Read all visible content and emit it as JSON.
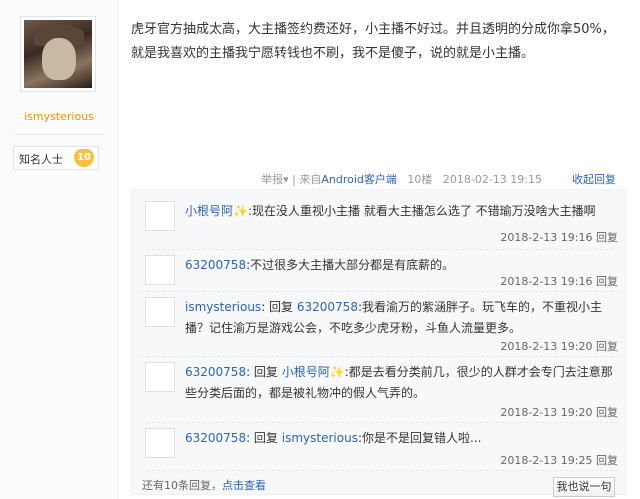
{
  "author": {
    "username": "ismysterious",
    "rank_label": "知名人士",
    "rank_level": "10"
  },
  "post": {
    "text": "虎牙官方抽成太高，大主播签约费还好，小主播不好过。并且透明的分成你拿50%，就是我喜欢的主播我宁愿转钱也不刷，我不是傻子，说的就是小主播。",
    "report": "举报",
    "report_arrow": "▾",
    "sep": "|",
    "from_prefix": "来自",
    "from_client": "Android客户端",
    "floor": "10楼",
    "time": "2018-02-13 19:15",
    "collapse_reply": "收起回复"
  },
  "comments": [
    {
      "user": "小根号阿",
      "sparkle": "✨",
      "text": ":现在没人重视小主播 就看大主播怎么选了 不错瑜万没啥大主播啊",
      "time": "2018-2-13 19:16",
      "reply": "回复"
    },
    {
      "user": "63200758",
      "text": ":不过很多大主播大部分都是有底薪的。",
      "time": "2018-2-13 19:16",
      "reply": "回复"
    },
    {
      "user": "ismysterious",
      "reply_prefix": ": 回复",
      "reply_to": "63200758",
      "text": ":我看渝万的紫涵胖子。玩飞车的，不重视小主播？记住渝万是游戏公会，不吃多少虎牙粉，斗鱼人流量更多。",
      "time": "2018-2-13 19:20",
      "reply": "回复"
    },
    {
      "user": "63200758",
      "reply_prefix": ": 回复",
      "reply_to": "小根号阿",
      "sparkle": "✨",
      "text": ":都是去看分类前几，很少的人群才会专门去注意那些分类后面的，都是被礼物冲的假人气弄的。",
      "time": "2018-2-13 19:20",
      "reply": "回复"
    },
    {
      "user": "63200758",
      "reply_prefix": ": 回复",
      "reply_to": "ismysterious",
      "text": ":你是不是回复错人啦...",
      "time": "2018-2-13 19:25",
      "reply": "回复"
    }
  ],
  "footer": {
    "more_text": "还有10条回复，",
    "view_link": "点击查看",
    "say_button": "我也说一句"
  },
  "colors": {
    "link": "#2d64b3",
    "username_orange": "#f29300",
    "badge": "#f6c143"
  }
}
